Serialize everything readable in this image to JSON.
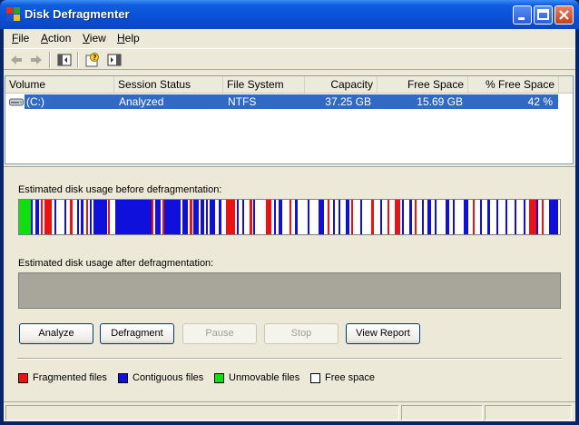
{
  "window": {
    "title": "Disk Defragmenter",
    "icon": "defrag-app-icon"
  },
  "menu": [
    {
      "key": "F",
      "rest": "ile"
    },
    {
      "key": "A",
      "rest": "ction"
    },
    {
      "key": "V",
      "rest": "iew"
    },
    {
      "key": "H",
      "rest": "elp"
    }
  ],
  "toolbar": [
    "back-arrow-icon",
    "forward-arrow-icon",
    "show-hide-console-tree-icon",
    "help-icon",
    "show-hide-action-pane-icon"
  ],
  "columns": [
    "Volume",
    "Session Status",
    "File System",
    "Capacity",
    "Free Space",
    "% Free Space"
  ],
  "volume": {
    "name": "(C:)",
    "status": "Analyzed",
    "file_system": "NTFS",
    "capacity": "37.25 GB",
    "free_space": "15.69 GB",
    "percent_free": "42 %"
  },
  "before_label": "Estimated disk usage before defragmentation:",
  "after_label": "Estimated disk usage after defragmentation:",
  "buttons": {
    "analyze": "Analyze",
    "defragment": "Defragment",
    "pause": "Pause",
    "stop": "Stop",
    "view_report": "View Report"
  },
  "legend": {
    "fragmented": "Fragmented files",
    "contiguous": "Contiguous files",
    "unmovable": "Unmovable files",
    "free": "Free space"
  },
  "colors": {
    "fragmented": "#ee1111",
    "contiguous": "#1010dd",
    "unmovable": "#11dd11",
    "free": "#ffffff",
    "selection": "#316ac5"
  }
}
